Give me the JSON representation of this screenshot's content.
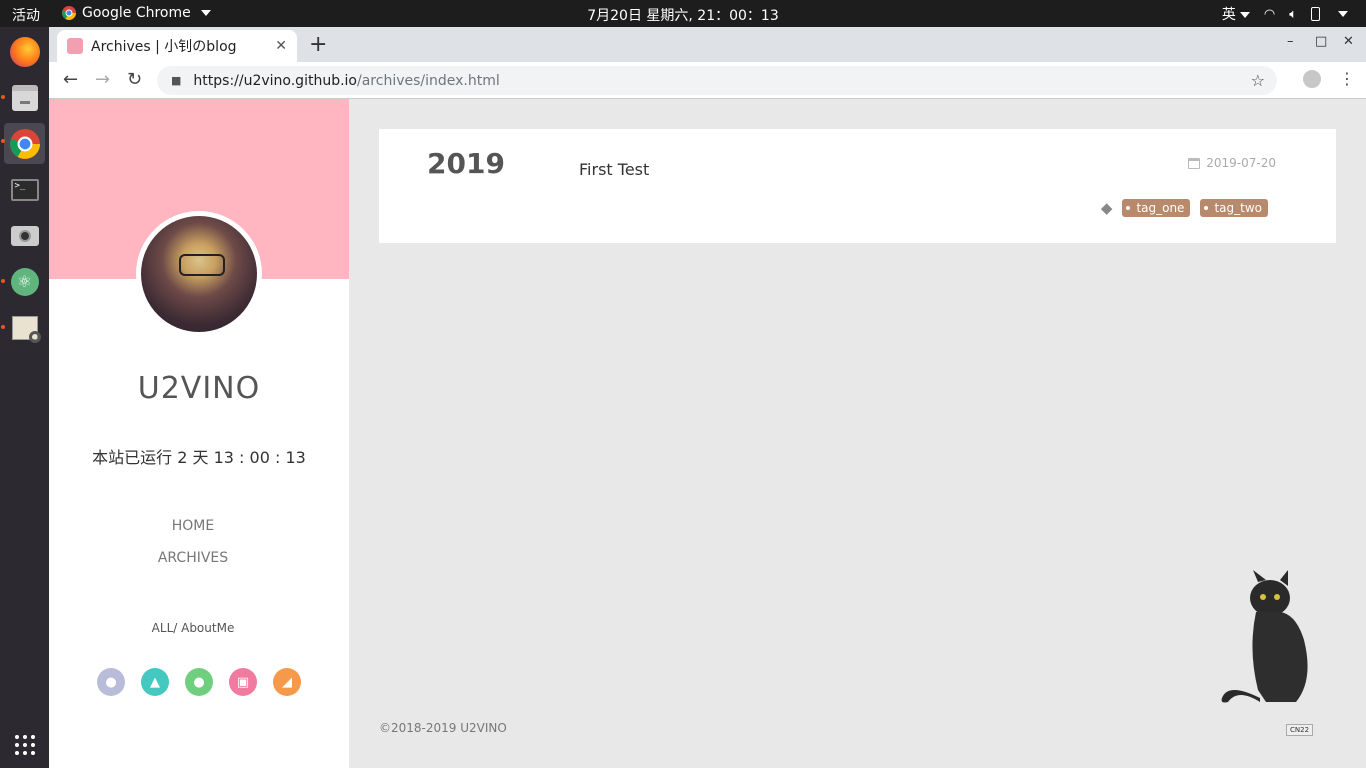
{
  "topbar": {
    "activities": "活动",
    "app_name": "Google Chrome",
    "clock": "7月20日 星期六, 21：00：13",
    "input_method": "英"
  },
  "browser": {
    "tab_title": "Archives | 小钊のblog",
    "url_host": "https://u2vino.github.io",
    "url_path": "/archives/index.html"
  },
  "sidebar": {
    "site_name": "U2VINO",
    "runtime": "本站已运行 2 天 13 : 00 : 13",
    "nav": [
      "HOME",
      "ARCHIVES"
    ],
    "about_line": "ALL/ AboutMe"
  },
  "archive": {
    "year": "2019",
    "post_title": "First Test",
    "post_date": "2019-07-20",
    "tags": [
      "tag_one",
      "tag_two"
    ]
  },
  "footer": {
    "copyright": "©2018-2019 U2VINO",
    "badge": "CN22"
  },
  "colors": {
    "hero_pink": "#ffb6c1",
    "tag_brown": "#b8896a",
    "github": "#b8bcd8",
    "qq": "#45c8c0",
    "wechat": "#6fcf7f",
    "bilibili": "#f07aa0",
    "rss": "#f59a4a"
  }
}
